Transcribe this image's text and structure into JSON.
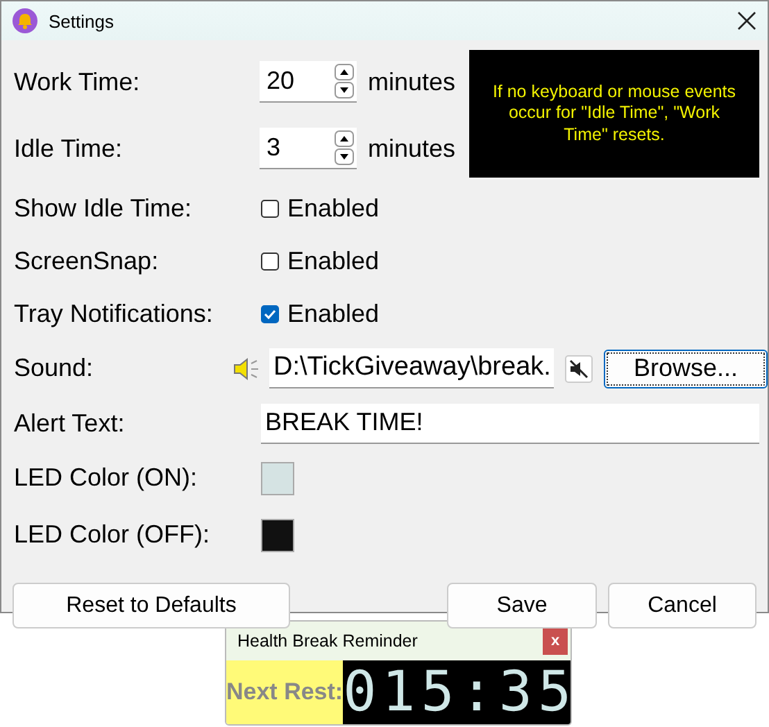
{
  "window": {
    "title": "Settings"
  },
  "fields": [
    {
      "kind": "spin",
      "label": "Work Time:",
      "value": "20",
      "unit": "minutes"
    },
    {
      "kind": "spin",
      "label": "Idle Time:",
      "value": "3",
      "unit": "minutes"
    },
    {
      "kind": "check",
      "label": "Show Idle Time:",
      "option": "Enabled",
      "checked": false
    },
    {
      "kind": "check",
      "label": "ScreenSnap:",
      "option": "Enabled",
      "checked": false
    },
    {
      "kind": "check",
      "label": "Tray Notifications:",
      "option": "Enabled",
      "checked": true
    },
    {
      "kind": "sound",
      "label": "Sound:",
      "value": "D:\\TickGiveaway\\break.",
      "button": "Browse..."
    },
    {
      "kind": "text",
      "label": "Alert Text:",
      "value": "BREAK TIME!"
    },
    {
      "kind": "color",
      "label": "LED Color (ON):",
      "color": "#d5e3e3"
    },
    {
      "kind": "color",
      "label": "LED Color (OFF):",
      "color": "#111111"
    }
  ],
  "info": "If no keyboard or mouse events occur for \"Idle Time\", \"Work Time\" resets.",
  "buttons": [
    "Reset to Defaults",
    "Save",
    "Cancel"
  ],
  "reminder": {
    "title": "Health Break Reminder",
    "close": "x",
    "label": "Next Rest:",
    "time": "015:35"
  }
}
